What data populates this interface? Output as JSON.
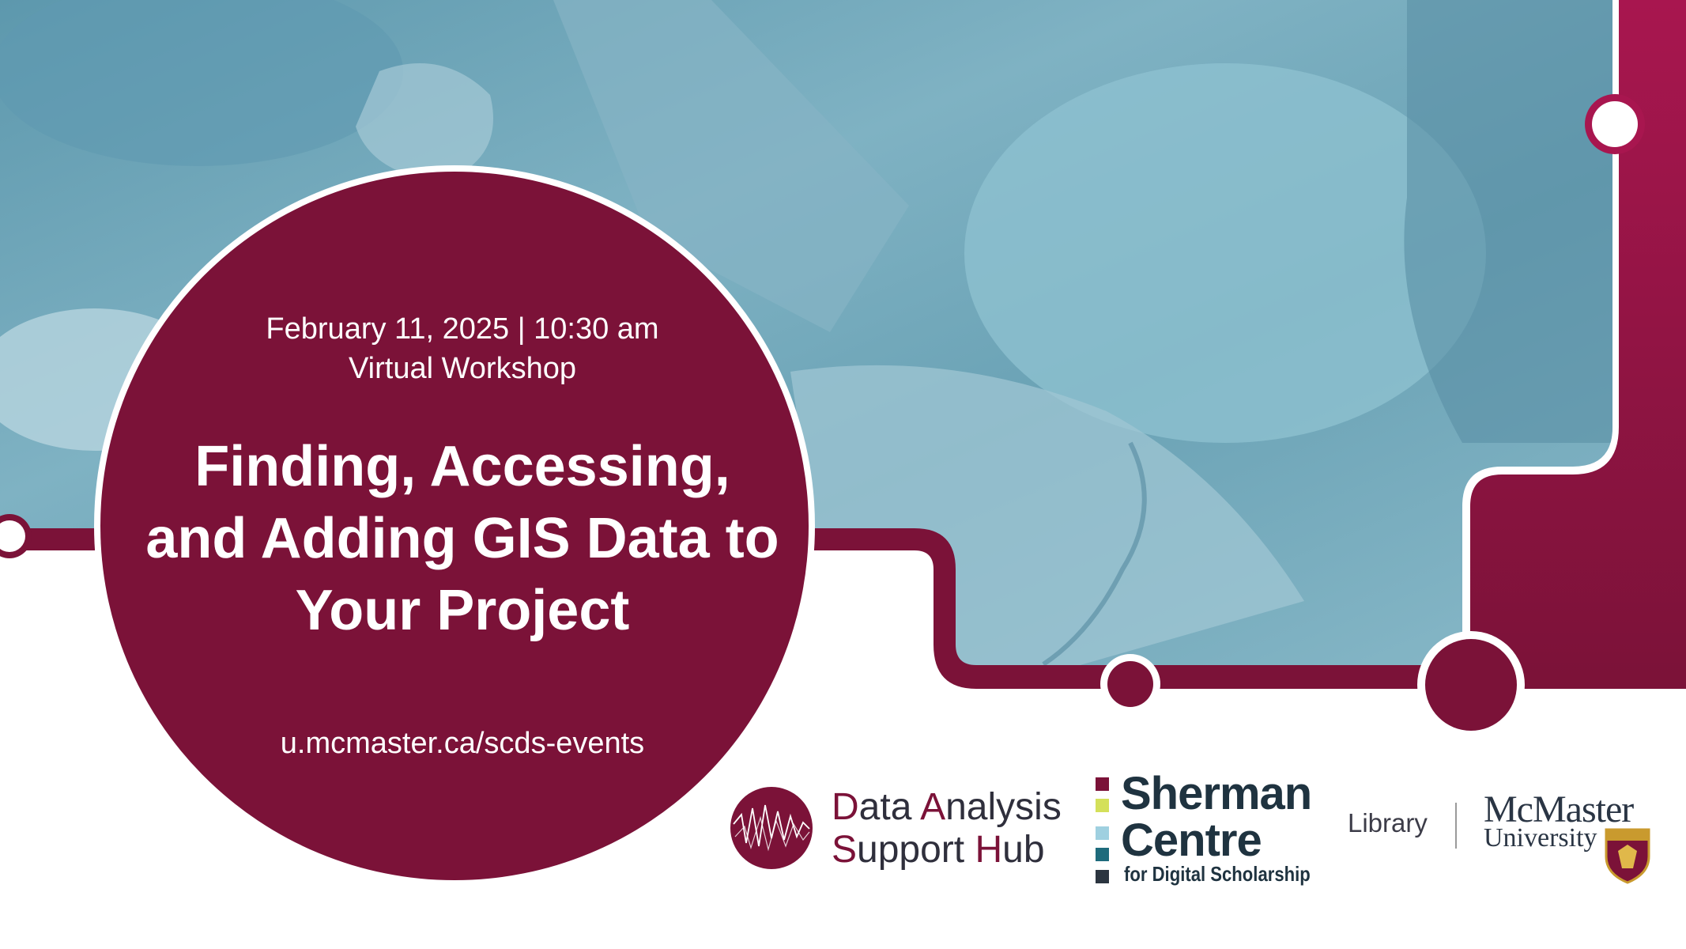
{
  "event": {
    "date_time": "February 11, 2025 | 10:30 am",
    "format": "Virtual Workshop",
    "title": "Finding, Accessing, and Adding GIS Data to Your Project",
    "url": "u.mcmaster.ca/scds-events"
  },
  "logos": {
    "dash": {
      "line1_cap1": "D",
      "line1_rest1": "ata ",
      "line1_cap2": "A",
      "line1_rest2": "nalysis",
      "line2_cap1": "S",
      "line2_rest1": "upport ",
      "line2_cap2": "H",
      "line2_rest2": "ub"
    },
    "sherman": {
      "line1": "Sherman",
      "line2": "Centre",
      "line3": "for Digital Scholarship"
    },
    "library": "Library",
    "mcmaster": {
      "name": "McMaster",
      "sub": "University"
    }
  },
  "colors": {
    "maroon": "#7b1238",
    "accent_pink": "#a8164f",
    "photo_teal": "#6fa5b8",
    "sherman_squares": [
      "#7b1238",
      "#d4e05a",
      "#9fd0e0",
      "#1e6b7c",
      "#2c3540"
    ]
  },
  "icons": [
    "dash-waveform-icon",
    "mcmaster-crest-icon"
  ]
}
